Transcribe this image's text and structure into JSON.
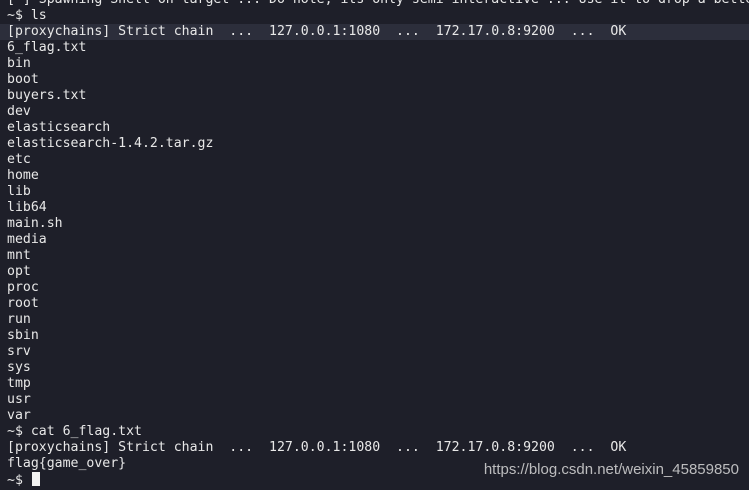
{
  "terminal": {
    "lines": [
      "[*] Spawning Shell on target ... Do note, its only semi-interactive ... Use it to drop a better",
      "~$ ls",
      "[proxychains] Strict chain  ...  127.0.0.1:1080  ...  172.17.0.8:9200  ...  OK",
      "6_flag.txt",
      "bin",
      "boot",
      "buyers.txt",
      "dev",
      "elasticsearch",
      "elasticsearch-1.4.2.tar.gz",
      "etc",
      "home",
      "lib",
      "lib64",
      "main.sh",
      "media",
      "mnt",
      "opt",
      "proc",
      "root",
      "run",
      "sbin",
      "srv",
      "sys",
      "tmp",
      "usr",
      "var",
      "~$ cat 6_flag.txt",
      "[proxychains] Strict chain  ...  127.0.0.1:1080  ...  172.17.0.8:9200  ...  OK",
      "flag{game_over}"
    ],
    "prompt": "~$ "
  },
  "watermark": "https://blog.csdn.net/weixin_45859850"
}
